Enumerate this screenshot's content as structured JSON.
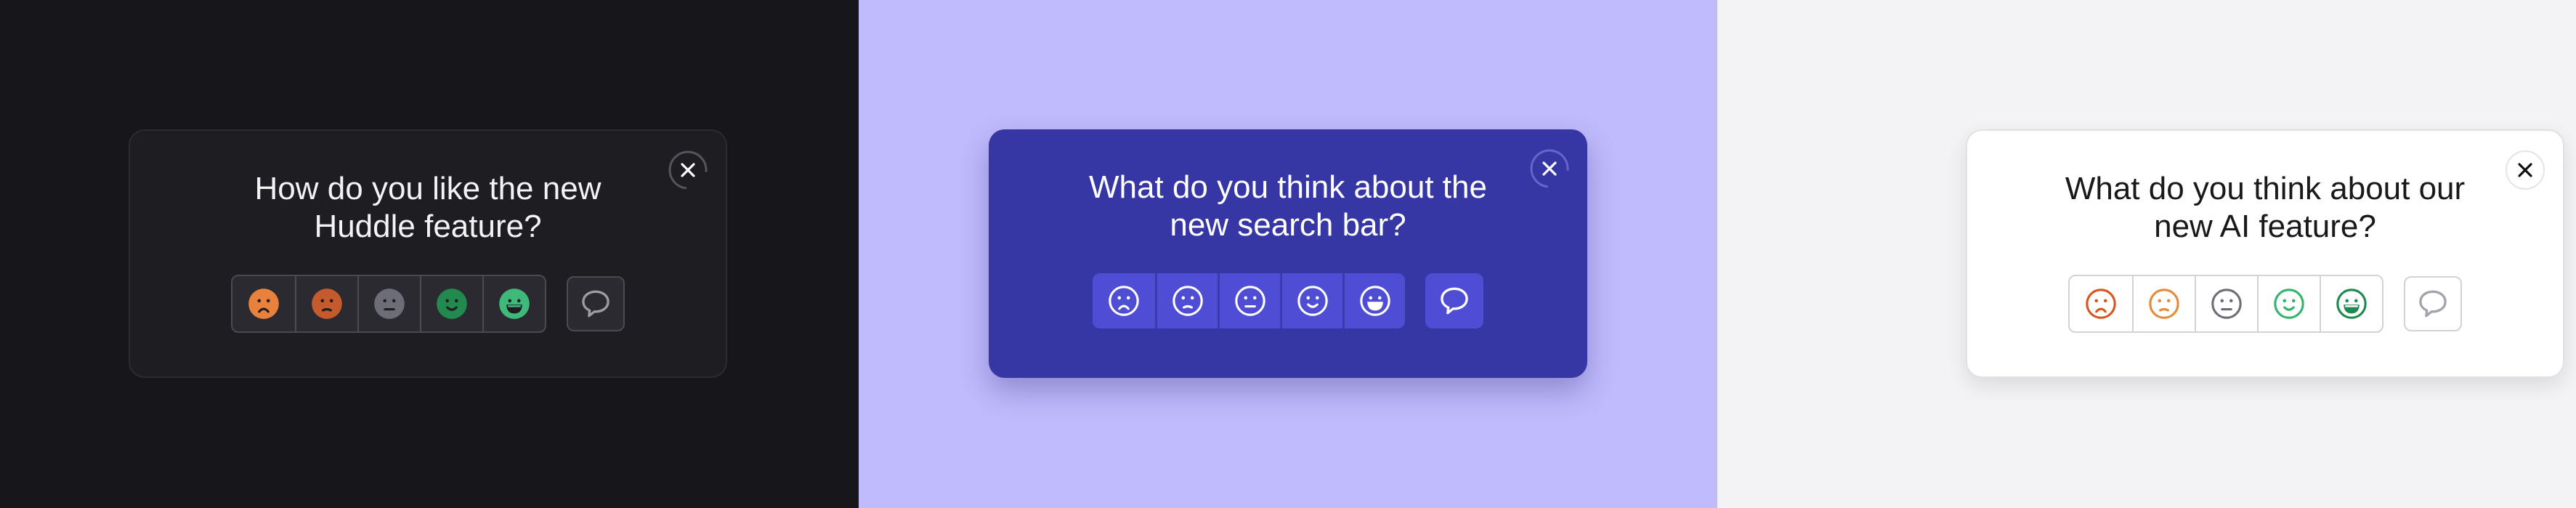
{
  "widgets": [
    {
      "theme": "dark",
      "question_line1": "How do you like the new",
      "question_line2": "Huddle feature?",
      "close_icon": "close-icon",
      "colors": {
        "panel_bg": "#16161b",
        "card_bg": "#1d1d22",
        "close": "#ffffff"
      },
      "ratings": [
        {
          "icon": "very-dissatisfied-face-icon",
          "style": "filled",
          "color": "#e8813c"
        },
        {
          "icon": "dissatisfied-face-icon",
          "style": "filled",
          "color": "#c55a2d"
        },
        {
          "icon": "neutral-face-icon",
          "style": "filled",
          "color": "#6d6d78"
        },
        {
          "icon": "satisfied-face-icon",
          "style": "filled",
          "color": "#22894f"
        },
        {
          "icon": "very-satisfied-face-icon",
          "style": "filled",
          "color": "#3fb97a"
        }
      ],
      "comment": {
        "icon": "speech-bubble-icon",
        "color": "#9c9ca6"
      }
    },
    {
      "theme": "purple",
      "question_line1": "What do you think about the",
      "question_line2": "new search bar?",
      "close_icon": "close-icon",
      "colors": {
        "panel_bg": "#c0bbfb",
        "card_bg": "#3736a5",
        "close": "#ffffff"
      },
      "ratings": [
        {
          "icon": "very-dissatisfied-face-icon",
          "style": "outline",
          "color": "#ffffff"
        },
        {
          "icon": "dissatisfied-face-icon",
          "style": "outline",
          "color": "#ffffff"
        },
        {
          "icon": "neutral-face-icon",
          "style": "outline",
          "color": "#ffffff"
        },
        {
          "icon": "satisfied-face-icon",
          "style": "outline",
          "color": "#ffffff"
        },
        {
          "icon": "very-satisfied-face-icon",
          "style": "outline",
          "color": "#ffffff"
        }
      ],
      "comment": {
        "icon": "speech-bubble-icon",
        "color": "#ffffff"
      }
    },
    {
      "theme": "light",
      "question_line1": "What do you think about our",
      "question_line2": "new AI feature?",
      "close_icon": "close-icon",
      "colors": {
        "panel_bg": "#f3f3f5",
        "card_bg": "#ffffff",
        "close": "#111111"
      },
      "ratings": [
        {
          "icon": "very-dissatisfied-face-icon",
          "style": "outline",
          "color": "#d9541f"
        },
        {
          "icon": "dissatisfied-face-icon",
          "style": "outline",
          "color": "#e8893a"
        },
        {
          "icon": "neutral-face-icon",
          "style": "outline",
          "color": "#6d6d78"
        },
        {
          "icon": "satisfied-face-icon",
          "style": "outline",
          "color": "#35b36c"
        },
        {
          "icon": "very-satisfied-face-icon",
          "style": "outline",
          "color": "#1f8a4f"
        }
      ],
      "comment": {
        "icon": "speech-bubble-icon",
        "color": "#a3a3ad"
      }
    }
  ]
}
